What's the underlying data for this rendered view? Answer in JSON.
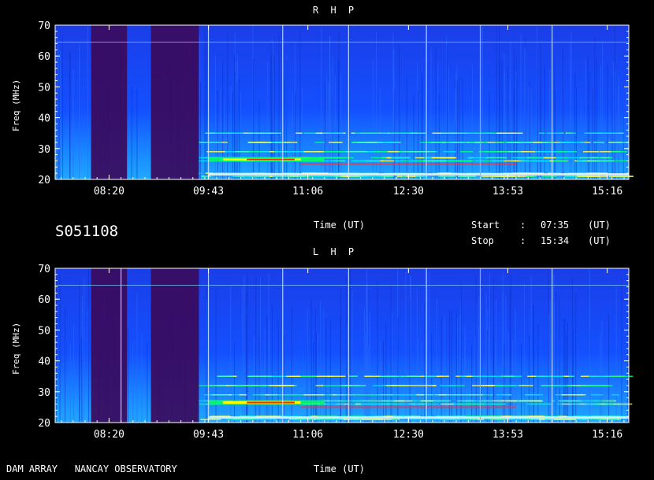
{
  "header": {
    "session_id": "S051108",
    "time_label_mid": "Time (UT)",
    "start_label": "Start",
    "stop_label": "Stop",
    "colon": ":",
    "start_value": "07:35",
    "stop_value": "15:34",
    "unit": "(UT)"
  },
  "footer": {
    "instrument": "DAM ARRAY   NANCAY OBSERVATORY",
    "time_label": "Time (UT)"
  },
  "chart_data": [
    {
      "type": "heatmap",
      "title": "R H P",
      "xlabel": "Time (UT)",
      "ylabel": "Freq (MHz)",
      "x_range": [
        "07:35",
        "15:34"
      ],
      "ylim": [
        20,
        70
      ],
      "x_ticks": [
        "08:20",
        "09:43",
        "11:06",
        "12:30",
        "13:53",
        "15:16"
      ],
      "y_ticks": [
        20,
        30,
        40,
        50,
        60,
        70
      ],
      "colormap": [
        "#000080",
        "#0000ff",
        "#00c0ff",
        "#00ff80",
        "#ffff00",
        "#ff0000",
        "#ffffff"
      ],
      "background_color": "#1040ff",
      "dark_bands": [
        [
          "08:05",
          "08:35"
        ],
        [
          "08:55",
          "09:35"
        ]
      ],
      "bright_vertical_lines": [
        "09:43",
        "10:45",
        "11:40",
        "12:45",
        "13:30",
        "14:30"
      ],
      "emission_bands_mhz": [
        21,
        22,
        26,
        27,
        29,
        32,
        35
      ]
    },
    {
      "type": "heatmap",
      "title": "L H P",
      "xlabel": "Time (UT)",
      "ylabel": "Freq (MHz)",
      "x_range": [
        "07:35",
        "15:34"
      ],
      "ylim": [
        20,
        70
      ],
      "x_ticks": [
        "08:20",
        "09:43",
        "11:06",
        "12:30",
        "13:53",
        "15:16"
      ],
      "y_ticks": [
        20,
        30,
        40,
        50,
        60,
        70
      ],
      "colormap": [
        "#000080",
        "#0000ff",
        "#00c0ff",
        "#00ff80",
        "#ffff00",
        "#ff0000",
        "#ffffff"
      ],
      "background_color": "#1040ff",
      "dark_bands": [
        [
          "08:05",
          "08:35"
        ],
        [
          "08:55",
          "09:35"
        ]
      ],
      "bright_vertical_lines": [
        "08:30",
        "09:43",
        "10:45",
        "11:40",
        "12:45",
        "13:30",
        "14:30"
      ],
      "emission_bands_mhz": [
        21,
        22,
        26,
        27,
        29,
        32,
        35
      ]
    }
  ]
}
